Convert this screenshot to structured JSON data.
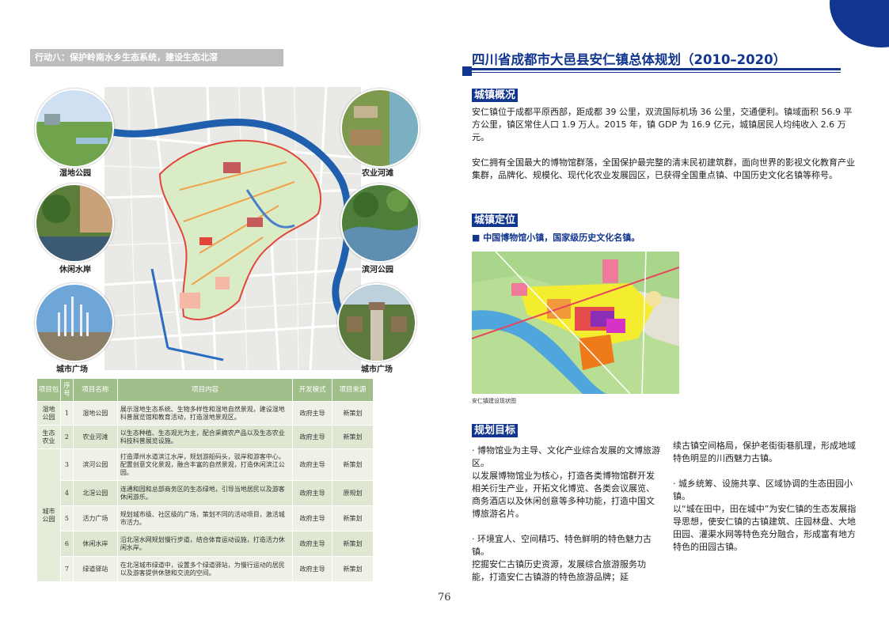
{
  "left": {
    "action_title": "行动八：保护岭南水乡生态系统，建设生态北滘",
    "photos": {
      "wetland": "湿地公园",
      "agri_river": "农业河滩",
      "leisure_shore": "休闲水岸",
      "binhe_park": "滨河公园",
      "city_square_left": "城市广场",
      "city_square_right": "城市广场"
    },
    "table": {
      "headers": [
        "项目包",
        "序号",
        "项目名称",
        "项目内容",
        "开发模式",
        "项目来源"
      ],
      "rows": [
        {
          "pkg": "湿地公园",
          "no": "1",
          "name": "湿地公园",
          "content": "展示湿地生态系统、生物多样性和湿地自然景观，建设湿地科普展览馆和教育活动，打造湿地景观区。",
          "mode": "政府主导",
          "source": "新策划"
        },
        {
          "pkg": "生态农业",
          "no": "2",
          "name": "农业河滩",
          "content": "以生态种植、生态观光为主，配合采摘农产品以及生态农业科技科普展览设施。",
          "mode": "政府主导",
          "source": "新策划"
        },
        {
          "pkg": "城市公园",
          "no": "3",
          "name": "滨河公园",
          "content": "打造潭州水道滨江水岸，规划游船码头，驳岸和游客中心。配置创意文化景观，融合丰富的自然景观，打造休闲滨江公园。",
          "mode": "政府主导",
          "source": "新策划"
        },
        {
          "pkg": "",
          "no": "4",
          "name": "北滘公园",
          "content": "连通和园和总部商务区的生态绿地，引导当地居民以及游客休闲游乐。",
          "mode": "政府主导",
          "source": "原规划"
        },
        {
          "pkg": "",
          "no": "5",
          "name": "活力广场",
          "content": "规划城市级、社区级的广场，策划不同的活动项目，激活城市活力。",
          "mode": "政府主导",
          "source": "新策划"
        },
        {
          "pkg": "",
          "no": "6",
          "name": "休闲水岸",
          "content": "沿北滘水网规划慢行步道，结合体育运动设施，打造活力休闲水岸。",
          "mode": "政府主导",
          "source": "新策划"
        },
        {
          "pkg": "",
          "no": "7",
          "name": "绿道驿站",
          "content": "在北滘城市绿道中，设置多个绿道驿站，为慢行运动的居民以及游客提供休憩和交流的空间。",
          "mode": "政府主导",
          "source": "新策划"
        }
      ]
    },
    "page_number": "76"
  },
  "right": {
    "title": "四川省成都市大邑县安仁镇总体规划（2010–2020）",
    "overview_heading": "城镇概况",
    "overview_p1": "安仁镇位于成都平原西部，距成都 39 公里，双流国际机场 36 公里，交通便利。镇域面积 56.9 平方公里，镇区常住人口 1.9 万人。2015 年，镇 GDP 为 16.9 亿元，城镇居民人均纯收入 2.6 万元。",
    "overview_p2": "安仁拥有全国最大的博物馆群落，全国保护最完整的清末民初建筑群，面向世界的影视文化教育产业集群，品牌化、规模化、现代化农业发展园区，已获得全国重点镇、中国历史文化名镇等称号。",
    "position_heading": "城镇定位",
    "position_bullet": "■ 中国博物馆小镇，国家级历史文化名镇。",
    "map_caption": "安仁镇建设现状图",
    "goals_heading": "规划目标",
    "goals_col1": "· 博物馆业为主导、文化产业综合发展的文博旅游区。\n以发展博物馆业为核心，打造各类博物馆群开发相关衍生产业，开拓文化博览、各类会议展览、商务酒店以及休闲创意等多种功能，打造中国文博旅游名片。\n\n· 环境宜人、空间精巧、特色鲜明的特色魅力古镇。\n挖掘安仁古镇历史资源，发展综合旅游服务功能，打造安仁古镇游的特色旅游品牌；延",
    "goals_col2": "续古镇空间格局，保护老街街巷肌理，形成地域特色明显的川西魅力古镇。\n\n· 城乡统筹、设施共享、区域协调的生态田园小镇。\n以“城在田中，田在城中”为安仁镇的生态发展指导思想，使安仁镇的古镇建筑、庄园林盘、大地田园、灌渠水网等特色充分融合，形成富有地方特色的田园古镇。"
  },
  "colors": {
    "brand_blue": "#12358f",
    "table_header_green": "#9fbe8a",
    "action_bar_gray": "#bdbdbd"
  }
}
